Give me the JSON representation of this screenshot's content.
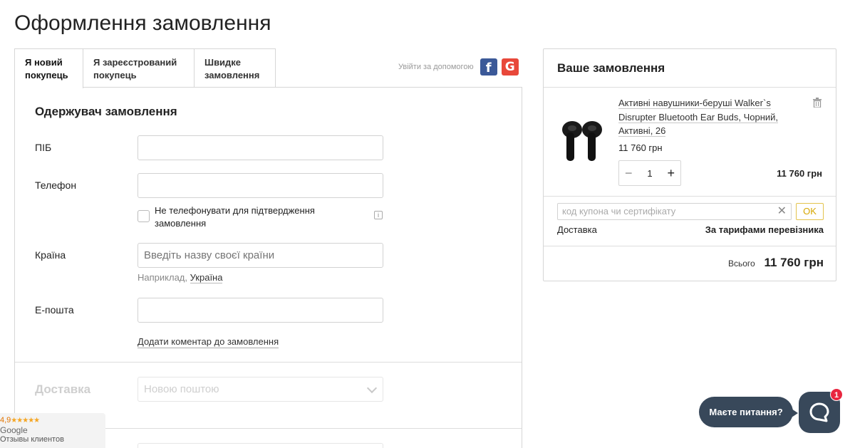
{
  "page": {
    "title": "Оформлення замовлення"
  },
  "tabs": [
    {
      "label": "Я новий покупець",
      "active": true
    },
    {
      "label": "Я зареєстрований покупець",
      "active": false
    },
    {
      "label": "Швидке замовлення",
      "active": false
    }
  ],
  "social_login": {
    "label": "Увійти за допомогою",
    "facebook_icon": "facebook-icon",
    "google_icon": "google-icon"
  },
  "recipient": {
    "section_title": "Одержувач замовлення",
    "name_label": "ПІБ",
    "name_value": "",
    "phone_label": "Телефон",
    "phone_value": "",
    "no_call_label": "Не телефонувати для підтвердження замовлення",
    "no_call_checked": false,
    "country_label": "Країна",
    "country_placeholder": "Введіть назву своєї країни",
    "country_hint_prefix": "Наприклад,",
    "country_hint_example": "Україна",
    "email_label": "E-пошта",
    "email_value": "",
    "add_comment": "Додати коментар до замовлення"
  },
  "delivery": {
    "label": "Доставка",
    "selected": "Новою поштою"
  },
  "order": {
    "title": "Ваше замовлення",
    "item": {
      "name": "Активні навушники-беруші Walker`s Disrupter Bluetooth Ear Buds, Чорний, Активні, 26",
      "unit_price": "11 760 грн",
      "quantity": "1",
      "line_total": "11 760 грн"
    },
    "coupon_placeholder": "код купона чи сертифікату",
    "coupon_button": "OK",
    "shipping_label": "Доставка",
    "shipping_value": "За тарифами перевізника",
    "total_label": "Всього",
    "total_value": "11 760 грн"
  },
  "chat": {
    "prompt": "Маєте питання?",
    "badge": "1"
  },
  "google_reviews": {
    "rating": "4,9",
    "stars": "★★★★★",
    "brand": "Google",
    "caption": "Отзывы клиентов"
  },
  "colors": {
    "accent": "#38485a",
    "badge": "#e8263f",
    "facebook": "#3b5998",
    "google": "#e8483a",
    "ok_border": "#e3c34d"
  }
}
